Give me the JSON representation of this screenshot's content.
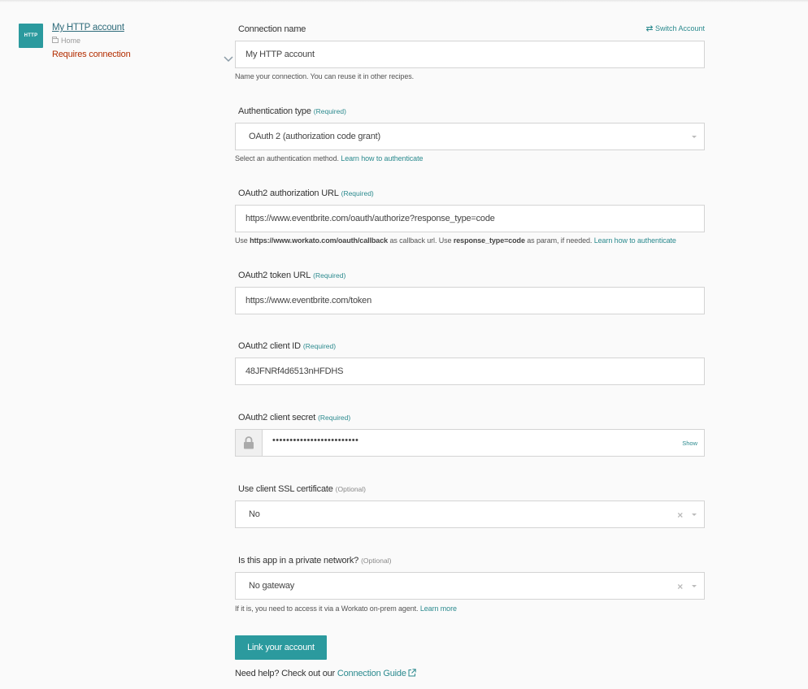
{
  "account": {
    "logo_text": "HTTP",
    "name": "My HTTP account",
    "folder": "Home",
    "status": "Requires connection",
    "status_color": "#b32d00"
  },
  "theme": {
    "accent": "#2b9a9e",
    "link": "#2b8a8e"
  },
  "switch_account": {
    "icon": "swap-arrows-icon",
    "label": "Switch Account"
  },
  "fields": {
    "connection_name": {
      "label": "Connection name",
      "value": "My  HTTP account",
      "hint": "Name your connection. You can reuse it in other recipes."
    },
    "auth_type": {
      "label": "Authentication type",
      "tag": "(Required)",
      "value": "OAuth 2 (authorization code grant)",
      "hint": "Select an authentication method.",
      "hint_link": "Learn how to authenticate"
    },
    "auth_url": {
      "label": "OAuth2 authorization URL",
      "tag": "(Required)",
      "value": "https://www.eventbrite.com/oauth/authorize?response_type=code",
      "hint_prefix": "Use",
      "hint_bold1": "https://www.workato.com/oauth/callback",
      "hint_mid": "as callback url. Use",
      "hint_bold2": "response_type=code",
      "hint_suffix": "as param, if needed.",
      "hint_link": "Learn how to authenticate"
    },
    "token_url": {
      "label": "OAuth2 token URL",
      "tag": "(Required)",
      "value": "https://www.eventbrite.com/token"
    },
    "client_id": {
      "label": "OAuth2 client ID",
      "tag": "(Required)",
      "value": "48JFNRf4d6513nHFDHS"
    },
    "client_secret": {
      "label": "OAuth2 client secret",
      "tag": "(Required)",
      "masked_value": "•••••••••••••••••••••••••",
      "show_label": "Show",
      "icon": "lock-icon"
    },
    "ssl_cert": {
      "label": "Use client SSL certificate",
      "tag": "(Optional)",
      "value": "No"
    },
    "private_network": {
      "label": "Is this app in a private network?",
      "tag": "(Optional)",
      "value": "No gateway",
      "hint": "If it is, you need to access it via a Workato on-prem agent.",
      "hint_link": "Learn more"
    }
  },
  "actions": {
    "link_account": "Link your account"
  },
  "help": {
    "prefix": "Need help? Check out our",
    "link": "Connection Guide",
    "icon": "external-link-icon"
  }
}
